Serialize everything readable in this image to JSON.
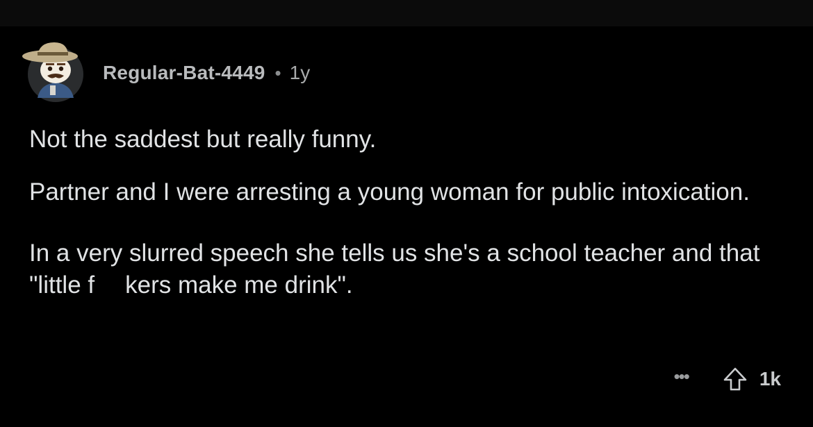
{
  "comment": {
    "username": "RegularBat-4449",
    "username_display": "Regular-Bat-4449",
    "separator": "•",
    "age": "1y",
    "paragraphs": [
      "Not the saddest but really funny.",
      "Partner and I were arresting a young woman for public intoxication.",
      "In a very slurred speech she tells us she's a school teacher and that \"little f"
    ],
    "paragraph3_tail": "kers make me drink\".",
    "more_label": "•••",
    "score": "1k",
    "avatar_icon": "snoo-cowboy-avatar-icon",
    "upvote_icon": "upvote-arrow-icon",
    "more_icon": "more-options-icon"
  },
  "colors": {
    "background": "#000000",
    "text": "#e1e3e5",
    "meta": "#a8aaab"
  }
}
